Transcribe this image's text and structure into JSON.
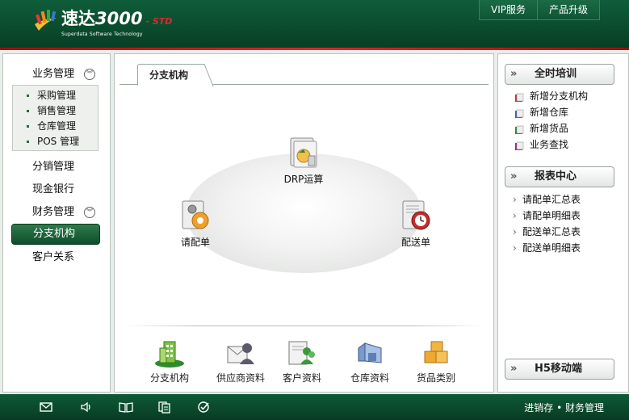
{
  "header": {
    "logo_title": "速达",
    "logo_number": "3000",
    "logo_edition": "- STD",
    "logo_subtitle": "Superdata Software Technology",
    "nav": [
      {
        "label": "VIP服务"
      },
      {
        "label": "产品升级"
      }
    ]
  },
  "sidebar": {
    "business": "业务管理",
    "sub": [
      "采购管理",
      "销售管理",
      "仓库管理",
      "POS 管理"
    ],
    "distribution": "分销管理",
    "cash": "现金银行",
    "finance": "财务管理",
    "branch": "分支机构",
    "customer": "客户关系"
  },
  "main": {
    "tab": "分支机构",
    "flow": {
      "drp": "DRP运算",
      "request": "请配单",
      "delivery": "配送单"
    },
    "dock": [
      {
        "label": "分支机构",
        "icon": "building-icon"
      },
      {
        "label": "供应商资料",
        "icon": "supplier-icon"
      },
      {
        "label": "客户资料",
        "icon": "customer-icon"
      },
      {
        "label": "仓库资料",
        "icon": "warehouse-icon"
      },
      {
        "label": "货品类别",
        "icon": "goods-boxes-icon"
      }
    ]
  },
  "right": {
    "training_title": "全时培训",
    "training_links": [
      "新增分支机构",
      "新增仓库",
      "新增货品",
      "业务查找"
    ],
    "report_title": "报表中心",
    "reports": [
      "请配单汇总表",
      "请配单明细表",
      "配送单汇总表",
      "配送单明细表"
    ],
    "h5_title": "H5移动端"
  },
  "footer": {
    "slogan": "进销存 • 财务管理"
  },
  "colors": {
    "brand_green": "#0a4a2d",
    "accent_red": "#d72c2c"
  }
}
